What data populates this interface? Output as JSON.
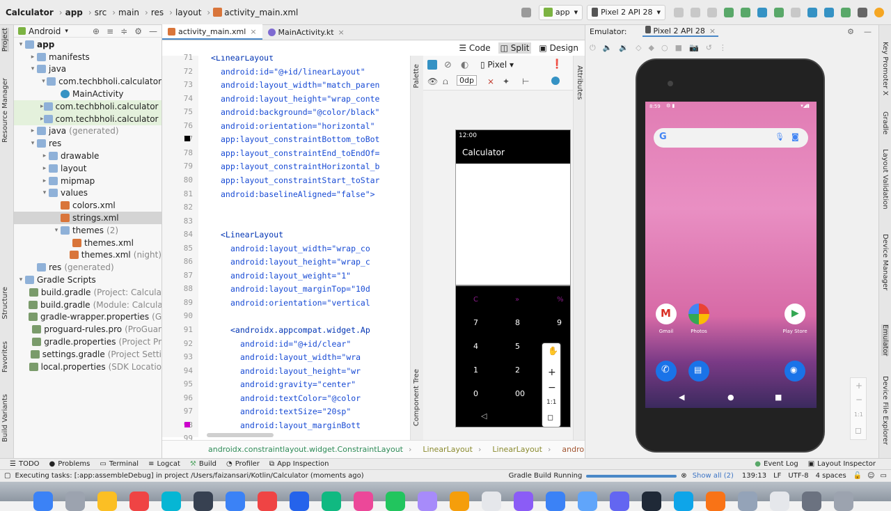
{
  "topbar": {
    "breadcrumbs": [
      "Calculator",
      "app",
      "src",
      "main",
      "res",
      "layout",
      "activity_main.xml"
    ],
    "run_config": "app",
    "device": "Pixel 2 API 28"
  },
  "left_stripe": [
    "Project",
    "Resource Manager",
    "Structure",
    "Favorites",
    "Build Variants"
  ],
  "right_stripe": [
    "Key Promoter X",
    "Gradle",
    "Layout Validation",
    "Device Manager",
    "Emulator",
    "Device File Explorer"
  ],
  "project_panel": {
    "view": "Android",
    "tree": [
      {
        "label": "app",
        "level": 0,
        "arrow": "▾",
        "bold": true
      },
      {
        "label": "manifests",
        "level": 1,
        "arrow": "▸"
      },
      {
        "label": "java",
        "level": 1,
        "arrow": "▾"
      },
      {
        "label": "com.techbholi.calculator",
        "level": 2,
        "arrow": "▾"
      },
      {
        "label": "MainActivity",
        "level": 3,
        "arrow": ""
      },
      {
        "label": "com.techbholi.calculator",
        "level": 2,
        "arrow": "▸",
        "suffix": "(",
        "hl": true
      },
      {
        "label": "com.techbholi.calculator",
        "level": 2,
        "arrow": "▸",
        "suffix": "(",
        "hl": true
      },
      {
        "label": "java",
        "level": 1,
        "arrow": "▸",
        "suffix": "(generated)"
      },
      {
        "label": "res",
        "level": 1,
        "arrow": "▾"
      },
      {
        "label": "drawable",
        "level": 2,
        "arrow": "▸"
      },
      {
        "label": "layout",
        "level": 2,
        "arrow": "▸"
      },
      {
        "label": "mipmap",
        "level": 2,
        "arrow": "▸"
      },
      {
        "label": "values",
        "level": 2,
        "arrow": "▾"
      },
      {
        "label": "colors.xml",
        "level": 3,
        "arrow": ""
      },
      {
        "label": "strings.xml",
        "level": 3,
        "arrow": "",
        "selected": true
      },
      {
        "label": "themes",
        "level": 3,
        "arrow": "▾",
        "suffix": "(2)"
      },
      {
        "label": "themes.xml",
        "level": 4,
        "arrow": ""
      },
      {
        "label": "themes.xml",
        "level": 4,
        "arrow": "",
        "suffix": "(night)"
      },
      {
        "label": "res",
        "level": 1,
        "arrow": "",
        "suffix": "(generated)"
      },
      {
        "label": "Gradle Scripts",
        "level": 0,
        "arrow": "▾"
      },
      {
        "label": "build.gradle",
        "level": 1,
        "arrow": "",
        "suffix": "(Project: Calcula"
      },
      {
        "label": "build.gradle",
        "level": 1,
        "arrow": "",
        "suffix": "(Module: Calcula"
      },
      {
        "label": "gradle-wrapper.properties",
        "level": 1,
        "arrow": "",
        "suffix": "(G"
      },
      {
        "label": "proguard-rules.pro",
        "level": 1,
        "arrow": "",
        "suffix": "(ProGuar"
      },
      {
        "label": "gradle.properties",
        "level": 1,
        "arrow": "",
        "suffix": "(Project Pr"
      },
      {
        "label": "settings.gradle",
        "level": 1,
        "arrow": "",
        "suffix": "(Project Setti"
      },
      {
        "label": "local.properties",
        "level": 1,
        "arrow": "",
        "suffix": "(SDK Locatio"
      }
    ]
  },
  "editor": {
    "tabs": [
      "activity_main.xml",
      "MainActivity.kt"
    ],
    "modes": [
      "Code",
      "Split",
      "Design"
    ],
    "active_mode": "Split",
    "lines": [
      {
        "n": "71",
        "indent": 2,
        "text": "<LinearLayout",
        "kind": "tag"
      },
      {
        "n": "72",
        "indent": 3,
        "text": "android:id=\"@+id/linearLayout\""
      },
      {
        "n": "73",
        "indent": 3,
        "text": "android:layout_width=\"match_paren"
      },
      {
        "n": "74",
        "indent": 3,
        "text": "android:layout_height=\"wrap_conte"
      },
      {
        "n": "75",
        "indent": 3,
        "text": "android:background=\"@color/black\""
      },
      {
        "n": "76",
        "indent": 3,
        "text": "android:orientation=\"horizontal\""
      },
      {
        "n": "77",
        "indent": 3,
        "text": "app:layout_constraintBottom_toBot"
      },
      {
        "n": "78",
        "indent": 3,
        "text": "app:layout_constraintEnd_toEndOf="
      },
      {
        "n": "79",
        "indent": 3,
        "text": "app:layout_constraintHorizontal_b"
      },
      {
        "n": "80",
        "indent": 3,
        "text": "app:layout_constraintStart_toStar"
      },
      {
        "n": "81",
        "indent": 3,
        "text": "android:baselineAligned=\"false\">"
      },
      {
        "n": "82",
        "indent": 3,
        "text": ""
      },
      {
        "n": "83",
        "indent": 3,
        "text": ""
      },
      {
        "n": "84",
        "indent": 3,
        "text": "<LinearLayout",
        "kind": "tag"
      },
      {
        "n": "85",
        "indent": 4,
        "text": "android:layout_width=\"wrap_co"
      },
      {
        "n": "86",
        "indent": 4,
        "text": "android:layout_height=\"wrap_c"
      },
      {
        "n": "87",
        "indent": 4,
        "text": "android:layout_weight=\"1\""
      },
      {
        "n": "88",
        "indent": 4,
        "text": "android:layout_marginTop=\"10d"
      },
      {
        "n": "89",
        "indent": 4,
        "text": "android:orientation=\"vertical"
      },
      {
        "n": "90",
        "indent": 4,
        "text": ""
      },
      {
        "n": "91",
        "indent": 4,
        "text": "<androidx.appcompat.widget.Ap",
        "kind": "tag"
      },
      {
        "n": "92",
        "indent": 5,
        "text": "android:id=\"@+id/clear\""
      },
      {
        "n": "93",
        "indent": 5,
        "text": "android:layout_width=\"wra"
      },
      {
        "n": "94",
        "indent": 5,
        "text": "android:layout_height=\"wr"
      },
      {
        "n": "95",
        "indent": 5,
        "text": "android:gravity=\"center\""
      },
      {
        "n": "96",
        "indent": 5,
        "text": "android:textColor=\"@color"
      },
      {
        "n": "97",
        "indent": 5,
        "text": "android:textSize=\"20sp\""
      },
      {
        "n": "98",
        "indent": 5,
        "text": "android:layout_marginBott"
      },
      {
        "n": "99",
        "indent": 5,
        "text": ""
      }
    ],
    "breadcrumb": [
      "androidx.constraintlayout.widget.ConstraintLayout",
      "LinearLayout",
      "LinearLayout",
      "androidx.appcompa"
    ]
  },
  "design": {
    "palette_label": "Palette",
    "component_tree_label": "Component Tree",
    "attributes_label": "Attributes",
    "device": "Pixel",
    "dp": "0dp",
    "preview": {
      "time": "12:00",
      "title": "Calculator",
      "keys_top": [
        "C",
        "»",
        "%"
      ],
      "keys": [
        [
          "7",
          "8",
          "9"
        ],
        [
          "4",
          "5",
          ""
        ],
        [
          "1",
          "2",
          ""
        ],
        [
          "0",
          "00",
          ""
        ]
      ],
      "zoom_label": "1:1"
    }
  },
  "emulator": {
    "title": "Emulator:",
    "device_tab": "Pixel 2 API 28",
    "status_time": "8:59",
    "apps": [
      {
        "name": "Gmail",
        "color": "#ffffff"
      },
      {
        "name": "Photos",
        "color": "#ffffff"
      },
      {
        "name": "Play Store",
        "color": "#ffffff"
      }
    ],
    "zoom_label": "1:1"
  },
  "toolstrip": [
    "TODO",
    "Problems",
    "Terminal",
    "Logcat",
    "Build",
    "Profiler",
    "App Inspection"
  ],
  "toolstrip_right": [
    "Event Log",
    "Layout Inspector"
  ],
  "status": {
    "message": "Executing tasks: [:app:assembleDebug] in project /Users/faizansari/Kotlin/Calculator (moments ago)",
    "build": "Gradle Build Running",
    "show_all": "Show all (2)",
    "position": "139:13",
    "line_sep": "LF",
    "encoding": "UTF-8",
    "indent": "4 spaces"
  },
  "colors": {
    "accent": "#4a88c7",
    "code_text": "#174ad4",
    "string": "#067d17"
  }
}
